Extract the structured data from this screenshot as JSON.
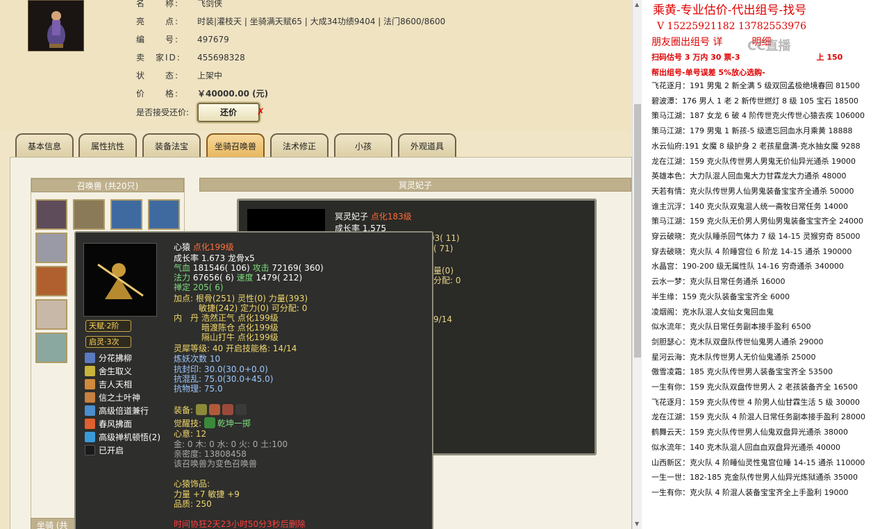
{
  "info": {
    "rows": [
      {
        "label": "名　　称:",
        "value": "飞剑侠"
      },
      {
        "label": "亮　　点:",
        "value": "时装|灌枝天 | 坐骑满天赋65 | 大成34功绩9404 | 法门8600/8600"
      },
      {
        "label": "编　　号:",
        "value": "497679"
      },
      {
        "label": "卖　家ID:",
        "value": "455698328"
      },
      {
        "label": "状　　态:",
        "value": "上架中"
      },
      {
        "label": "价　　格:",
        "value": "￥40000.00 (元)"
      }
    ],
    "bargain_label": "是否接受还价:",
    "bargain_button": "还价",
    "bargain_x": "✗"
  },
  "tabs": [
    "基本信息",
    "属性抗性",
    "装备法宝",
    "坐骑召唤兽",
    "法术修正",
    "小孩",
    "外观道具"
  ],
  "active_tab": "坐骑召唤兽",
  "pet_list_title": "召唤兽 (共20只)",
  "mount_title": "坐骑 (共",
  "detail_title": "冥灵妃子",
  "detail": {
    "name": "冥灵妃子",
    "level": "点化183级",
    "rate": "成长率 1.575",
    "frag1": "03( 11)",
    "frag2": "( 71)",
    "frag3": "量(0)",
    "frag4": "分配: 0",
    "frag5": "9/14"
  },
  "tooltip": {
    "name": "心猿",
    "level": "点化199级",
    "rate": "成长率 1.673 龙骨x5",
    "hp_label": "气血",
    "hp": "181546( 106)",
    "atk_label": "攻击",
    "atk": "72169( 360)",
    "mp_label": "法力",
    "mp": "67656( 6)",
    "spd_label": "速度",
    "spd": "1479( 212)",
    "zen": "禅定 205( 6)",
    "add1": "加点:  根骨(251) 灵性(0) 力量(393)",
    "add2": "敏捷(242) 定力(0) 可分配: 0",
    "dan_label": "内　丹",
    "dan1": "浩然正气 点化199级",
    "dan2": "暗渡陈仓 点化199级",
    "dan3": "隔山打牛 点化199级",
    "soul": "灵犀等级:  40 开启技能格: 14/14",
    "refine": "炼妖次数 10",
    "res1": "抗封印: 30.0(30.0+0.0)",
    "res2": "抗混乱: 75.0(30.0+45.0)",
    "res3": "抗物理: 75.0",
    "equip_label": "装备:",
    "awaken_label": "觉醒技:",
    "awaken": "乾坤一掷",
    "intent": "心意:  12",
    "elements": "金: 0 木: 0 水: 0 火: 0 土:100",
    "intimacy": "亲密度: 13808458",
    "note": "该召唤兽为变色召唤兽",
    "acc_label": "心猿饰品:",
    "acc1": "力量 +7 敏捷 +9",
    "acc2": "品质:  250",
    "time": "时间协狂2天23小时50分3秒后删除"
  },
  "badges": [
    "天赋·2阶",
    "启灵·3次"
  ],
  "skills": [
    "分花拂柳",
    "舍生取义",
    "吉人天相",
    "信之土叶神",
    "高级倍道兼行",
    "春风拂面",
    "高级禅机顿悟(2)",
    "已开启"
  ],
  "skill_colors": [
    "#5a7ac0",
    "#c9b43a",
    "#d08a3a",
    "#c88040",
    "#4a8ed0",
    "#e06030",
    "#3a9ad8",
    "#333"
  ],
  "notes": {
    "title": "乘黄-专业估价-代出组号-找号",
    "contact": "V 15225921182  13782553976",
    "ad": "朋友圈出组号  详",
    "ad2": "明细",
    "red1": "扫码估号 3 万内 30 票-3",
    "red1b": "上 150",
    "red2": "帮出组号-单号误差 5%放心选购-",
    "items": [
      "飞花逐月：191 男鬼 2 新全满 5 级双回孟极绝境春回 81500",
      "碧波潭：176 男人 1 老 2 新传世燃灯 8 级 105 宝石 18500",
      "策马江湖：187 女龙 6 破 4 阶传世克火传世心猿去疾 106000",
      "策马江湖：179 男鬼 1 新孩-5 级遗忘回血水月乘黄 18888",
      "水云仙府:191 女魔 8 级护身 2 老孩星盘满-克水抽女魔 9288",
      "龙在江湖：159 克火队传世男人男鬼无价仙异光通杀 19000",
      "英雄本色：大力队混人回血鬼大力甘霖龙大力通杀 48000",
      "天若有情：克火队传世男人仙男鬼装备宝宝齐全通杀 50000",
      "谁主沉浮：140 克火队双鬼混人统一斋牧日常任务 14000",
      "策马江湖：159 克火队无价男人男仙男鬼装备宝宝齐全 24000",
      "穿云破晓：克火队睡杀回气体力 7 级 14-15 灵猴穷奇 85000",
      "穿去破晓：克火队 4 阶睡宫位 6 阶龙 14-15 通杀 190000",
      "水晶宫：190-200 级无属性队 14-16 穷奇通杀 340000",
      "云水一梦：克火队日常任务通杀 16000",
      "半生缘：159 克火队装备宝宝齐全 6000",
      "凌烟阁：克水队混人女仙女鬼回血鬼",
      "似水流年：克火队日常任务副本接手盈利 6500",
      "剑胆瑟心：克木队双盘队传世仙鬼男人通杀 29000",
      "星河云海：克木队传世男人无价仙鬼通杀 25000",
      "傲雪凌霜：185 克火队传世男人装备宝宝齐全 53500",
      "一生有你：159 克火队双盘传世男人 2 老孩装备齐全 16500",
      "飞花逐月：159 克火队传世 4 阶男人仙甘霖生活 5 级 30000",
      "龙在江湖：159 克火队 4 阶混人日常任务副本接手盈利 28000",
      "鹤舞云天：159 克火队传世男人仙鬼双盘异光通杀 38000",
      "似水流年：140 克木队混人回血血双盘异光通杀 40000",
      "山西新区：克火队 4 阶睡仙灵性鬼宫位睡 14-15 通杀 110000",
      "一生一世：182-185 克金队传世男人仙异光炼狱通杀 35000",
      "一生有你：克火队 4 阶混人装备宝宝齐全上手盈利 19000"
    ],
    "watermark": "CC直播"
  }
}
